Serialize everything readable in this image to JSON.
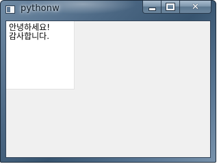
{
  "window": {
    "title": "pythonw",
    "icon": "python-window-icon"
  },
  "caption_buttons": {
    "minimize": "minimize-icon",
    "maximize": "maximize-icon",
    "close": "close-icon",
    "close_glyph": "✕"
  },
  "content": {
    "lines": [
      "안녕하세요!",
      "감사합니다."
    ]
  },
  "colors": {
    "client_background": "#f0f0f0",
    "text_background": "#ffffff",
    "text_color": "#000000"
  }
}
